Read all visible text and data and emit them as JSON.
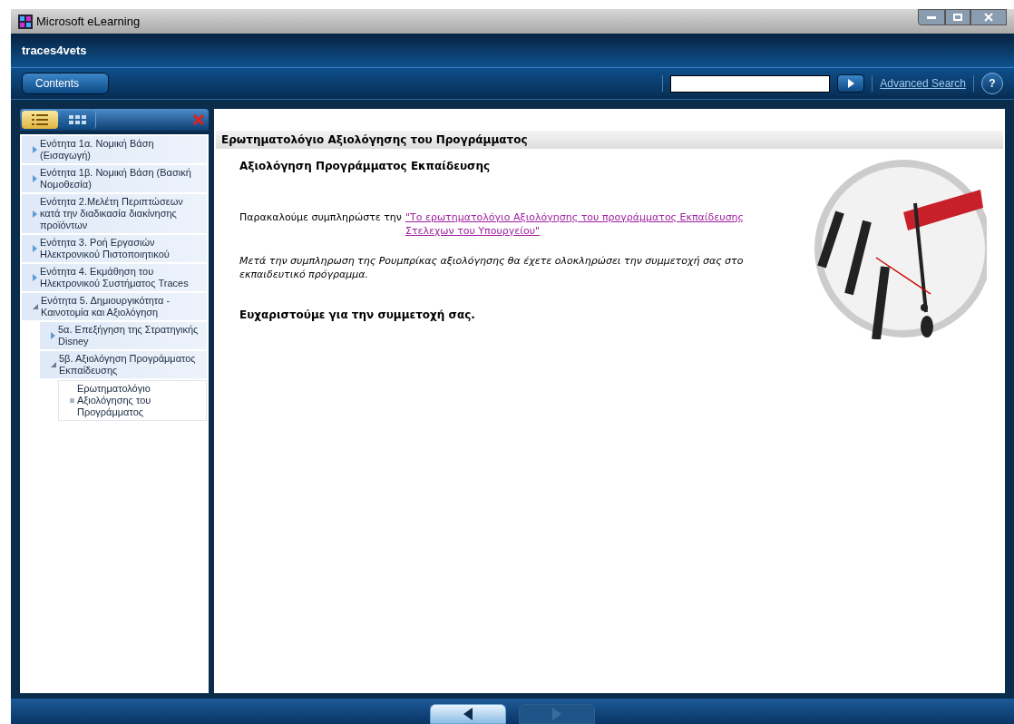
{
  "window": {
    "title": "Microsoft eLearning"
  },
  "header": {
    "title": "traces4vets"
  },
  "toolbar": {
    "contents_button": "Contents",
    "advanced_search": "Advanced Search",
    "help": "?"
  },
  "sidebar": {
    "view_tabs": [
      {
        "kind": "list",
        "selected": true
      },
      {
        "kind": "grid",
        "selected": false
      }
    ],
    "tree": [
      {
        "label": "Ενότητα 1α. Νομική Βάση (Εισαγωγή)",
        "expanded": false,
        "selected": false
      },
      {
        "label": "Ενότητα 1β. Νομική Βάση (Βασική Νομοθεσία)",
        "expanded": false,
        "selected": false
      },
      {
        "label": "Ενότητα 2.Μελέτη Περιπτώσεων κατά την διαδικασία διακίνησης προϊόντων",
        "expanded": false,
        "selected": false
      },
      {
        "label": "Ενότητα 3. Ροή Εργασιών Ηλεκτρονικού Πιστοποιητικού",
        "expanded": false,
        "selected": false
      },
      {
        "label": "Ενότητα 4. Εκμάθηση του Ηλεκτρονικού Συστήματος Traces",
        "expanded": false,
        "selected": false
      },
      {
        "label": "Ενότητα 5. Δημιουργικότητα - Καινοτομία και Αξιολόγηση",
        "expanded": true,
        "selected": false,
        "children": [
          {
            "label": "5α. Επεξήγηση της Στρατηγικής Disney",
            "expanded": false,
            "selected": false
          },
          {
            "label": "5β. Αξιολόγηση Προγράμματος Εκπαίδευσης",
            "expanded": true,
            "selected": false,
            "children": [
              {
                "label": "Ερωτηματολόγιο Αξιολόγησης του Προγράμματος",
                "kind": "page",
                "selected": true
              }
            ]
          }
        ]
      }
    ]
  },
  "content": {
    "page_title": "Ερωτηματολόγιο Αξιολόγησης του Προγράμματος",
    "heading": "Αξιολόγηση Προγράμματος Εκπαίδευσης",
    "request_text": "Παρακαλούμε συμπληρώστε την",
    "request_link": "\"Το ερωτηματολόγιο Αξιολόγησης του προγράμματος Εκπαίδευσης Στελεχων του Υπουργείου\"",
    "note": "Μετά την συμπληρωση της Ρουμπρίκας αξιολόγησης θα έχετε ολοκληρώσει την συμμετοχή σας στο εκπαιδευτικό πρόγραμμα.",
    "thanks": "Ευχαριστούμε για την συμμετοχή σας."
  }
}
